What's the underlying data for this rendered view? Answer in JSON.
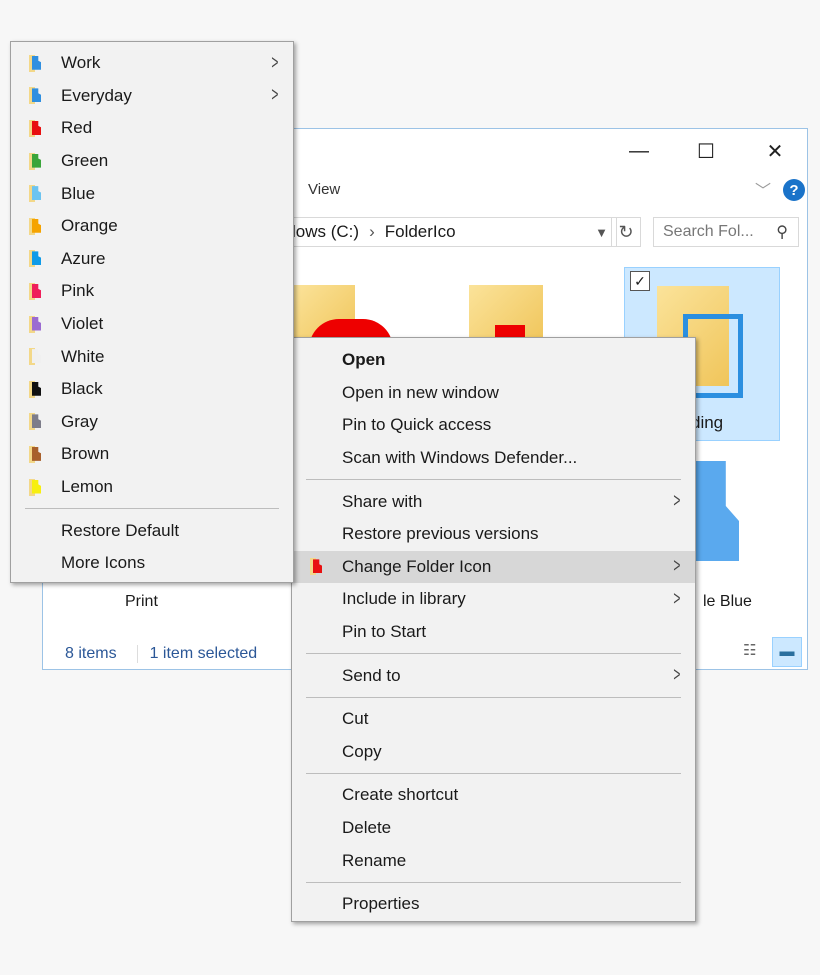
{
  "window": {
    "controls": {
      "minimize": "—",
      "maximize": "☐",
      "close": "✕"
    },
    "ribbon_tabs": [
      "View"
    ],
    "help": "?",
    "address": {
      "segments": [
        "lows (C:)",
        "FolderIco"
      ],
      "separator": "›"
    },
    "search_placeholder": "Search Fol...",
    "items": [
      {
        "label": "Print"
      },
      {
        "label": "ding",
        "selected": true
      },
      {
        "label": "le Blue"
      }
    ],
    "status": {
      "count": "8 items",
      "selected": "1 item selected"
    }
  },
  "context_menu": {
    "groups": [
      [
        {
          "label": "Open",
          "bold": true
        },
        {
          "label": "Open in new window"
        },
        {
          "label": "Pin to Quick access"
        },
        {
          "label": "Scan with Windows Defender..."
        }
      ],
      [
        {
          "label": "Share with",
          "submenu": true
        },
        {
          "label": "Restore previous versions"
        },
        {
          "label": "Change Folder Icon",
          "submenu": true,
          "highlighted": true,
          "icon": "red-folder-icon"
        },
        {
          "label": "Include in library",
          "submenu": true
        },
        {
          "label": "Pin to Start"
        }
      ],
      [
        {
          "label": "Send to",
          "submenu": true
        }
      ],
      [
        {
          "label": "Cut"
        },
        {
          "label": "Copy"
        }
      ],
      [
        {
          "label": "Create shortcut"
        },
        {
          "label": "Delete"
        },
        {
          "label": "Rename"
        }
      ],
      [
        {
          "label": "Properties"
        }
      ]
    ]
  },
  "icon_submenu": {
    "items": [
      {
        "label": "Work",
        "submenu": true,
        "icon": "gear-folder-icon",
        "color": "#2f8fe0"
      },
      {
        "label": "Everyday",
        "submenu": true,
        "icon": "download-folder-icon",
        "color": "#2f8fe0"
      },
      {
        "label": "Red",
        "color": "#e81010"
      },
      {
        "label": "Green",
        "color": "#3aa53a"
      },
      {
        "label": "Blue",
        "color": "#6cc4f0"
      },
      {
        "label": "Orange",
        "color": "#f5a300"
      },
      {
        "label": "Azure",
        "color": "#0f9be8"
      },
      {
        "label": "Pink",
        "color": "#ef1f5a"
      },
      {
        "label": "Violet",
        "color": "#9b6bd1"
      },
      {
        "label": "White",
        "color": "#f0f0f0"
      },
      {
        "label": "Black",
        "color": "#111111"
      },
      {
        "label": "Gray",
        "color": "#7d7d8a"
      },
      {
        "label": "Brown",
        "color": "#a8602c"
      },
      {
        "label": "Lemon",
        "color": "#f7ef10"
      }
    ],
    "footer": [
      {
        "label": "Restore Default"
      },
      {
        "label": "More Icons"
      }
    ]
  }
}
